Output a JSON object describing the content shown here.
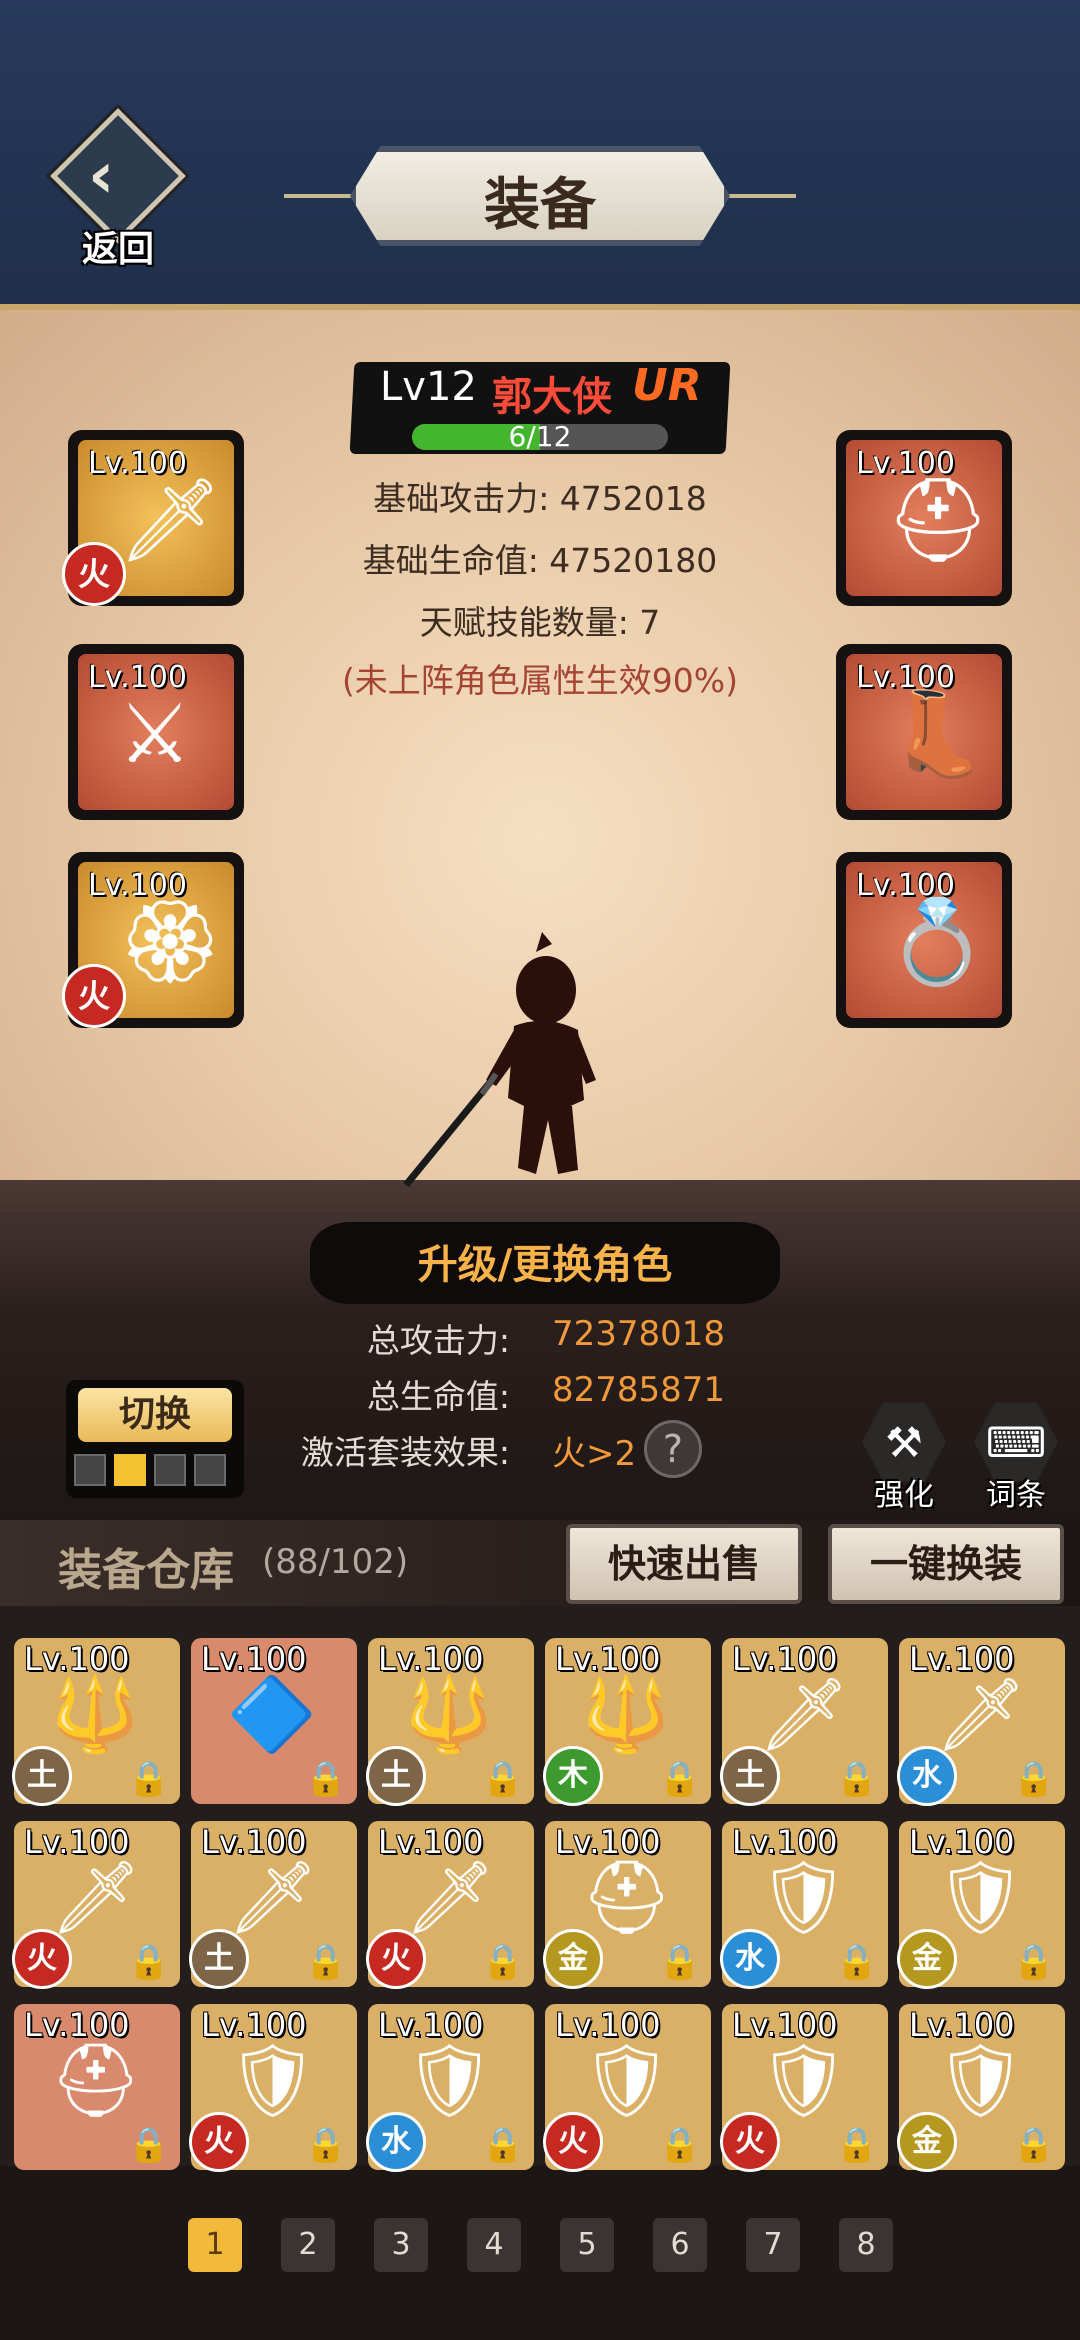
{
  "header": {
    "back_label": "返回",
    "title": "装备"
  },
  "character": {
    "level": "Lv12",
    "name": "郭大侠",
    "rarity": "UR",
    "exp_text": "6/12",
    "exp_fraction": 0.5,
    "stats": [
      "基础攻击力: 4752018",
      "基础生命值: 47520180",
      "天赋技能数量: 7"
    ],
    "effect_note": "(未上阵角色属性生效90%)"
  },
  "equip_slots": [
    {
      "lv": "Lv.100",
      "icon": "sword-icon",
      "element": "火",
      "bg": "gold"
    },
    {
      "lv": "Lv.100",
      "icon": "helmet-icon",
      "element": "",
      "bg": "red"
    },
    {
      "lv": "Lv.100",
      "icon": "shield-blade-icon",
      "element": "",
      "bg": "red"
    },
    {
      "lv": "Lv.100",
      "icon": "boots-icon",
      "element": "",
      "bg": "red"
    },
    {
      "lv": "Lv.100",
      "icon": "amulet-icon",
      "element": "火",
      "bg": "gold"
    },
    {
      "lv": "Lv.100",
      "icon": "ring-icon",
      "element": "",
      "bg": "red"
    }
  ],
  "upgrade_label": "升级/更换角色",
  "totals": {
    "attack_label": "总攻击力:",
    "attack_value": "72378018",
    "hp_label": "总生命值:",
    "hp_value": "82785871",
    "set_label": "激活套装效果:",
    "set_value": "火>2"
  },
  "switch": {
    "label": "切换",
    "pages": 4,
    "active": 1
  },
  "tools": {
    "strengthen": "强化",
    "affix": "词条"
  },
  "warehouse": {
    "title": "装备仓库",
    "count": "(88/102)",
    "quick_sell": "快速出售",
    "one_click": "一键换装"
  },
  "items": [
    {
      "lv": "Lv.100",
      "element": "土",
      "icon": "spear-icon",
      "bg": "gold"
    },
    {
      "lv": "Lv.100",
      "element": "",
      "icon": "crystal-dagger-icon",
      "bg": "red"
    },
    {
      "lv": "Lv.100",
      "element": "土",
      "icon": "spear-icon",
      "bg": "gold"
    },
    {
      "lv": "Lv.100",
      "element": "木",
      "icon": "spear-icon",
      "bg": "gold"
    },
    {
      "lv": "Lv.100",
      "element": "土",
      "icon": "golden-blade-icon",
      "bg": "gold"
    },
    {
      "lv": "Lv.100",
      "element": "水",
      "icon": "purple-blade-icon",
      "bg": "gold"
    },
    {
      "lv": "Lv.100",
      "element": "火",
      "icon": "golden-blade-icon",
      "bg": "gold"
    },
    {
      "lv": "Lv.100",
      "element": "土",
      "icon": "golden-blade-icon",
      "bg": "gold"
    },
    {
      "lv": "Lv.100",
      "element": "火",
      "icon": "purple-blade-icon",
      "bg": "gold"
    },
    {
      "lv": "Lv.100",
      "element": "金",
      "icon": "gold-helmet-icon",
      "bg": "gold"
    },
    {
      "lv": "Lv.100",
      "element": "水",
      "icon": "silver-armor-icon",
      "bg": "gold"
    },
    {
      "lv": "Lv.100",
      "element": "金",
      "icon": "steel-armor-icon",
      "bg": "gold"
    },
    {
      "lv": "Lv.100",
      "element": "",
      "icon": "helmet-icon",
      "bg": "red"
    },
    {
      "lv": "Lv.100",
      "element": "火",
      "icon": "green-armor-icon",
      "bg": "gold"
    },
    {
      "lv": "Lv.100",
      "element": "水",
      "icon": "green-armor-icon",
      "bg": "gold"
    },
    {
      "lv": "Lv.100",
      "element": "火",
      "icon": "dark-armor-icon",
      "bg": "gold"
    },
    {
      "lv": "Lv.100",
      "element": "火",
      "icon": "red-armor-icon",
      "bg": "gold"
    },
    {
      "lv": "Lv.100",
      "element": "金",
      "icon": "dark-armor-icon",
      "bg": "gold"
    }
  ],
  "pagination": {
    "pages": [
      "1",
      "2",
      "3",
      "4",
      "5",
      "6",
      "7",
      "8"
    ],
    "active": "1"
  }
}
